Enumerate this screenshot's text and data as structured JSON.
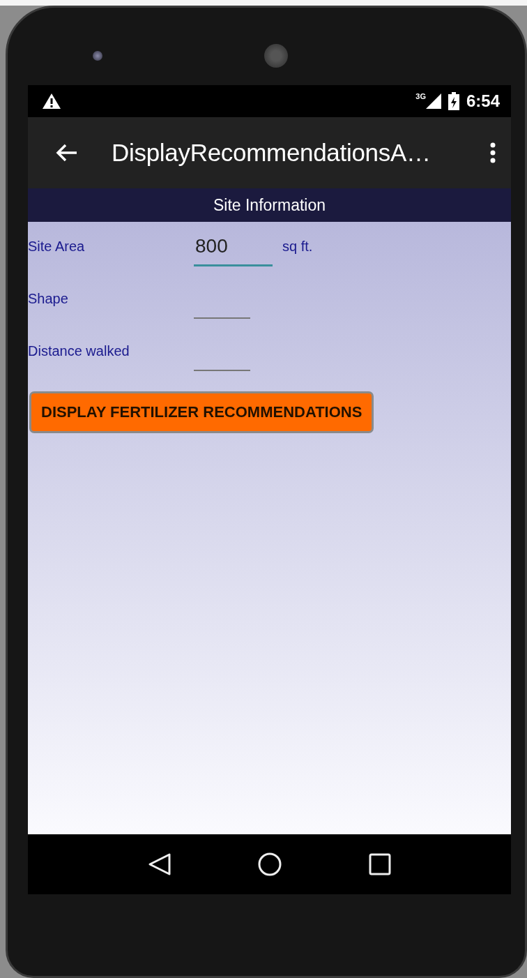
{
  "status_bar": {
    "time": "6:54",
    "network": "3G"
  },
  "app_bar": {
    "title": "DisplayRecommendationsA…"
  },
  "section": {
    "title": "Site Information"
  },
  "fields": [
    {
      "label": "Site Area",
      "value": "800",
      "unit": "sq ft.",
      "focused": true
    },
    {
      "label": "Shape",
      "focused": false
    },
    {
      "label": "Distance walked",
      "focused": false
    }
  ],
  "button": {
    "label": "DISPLAY FERTILIZER RECOMMENDATIONS"
  }
}
